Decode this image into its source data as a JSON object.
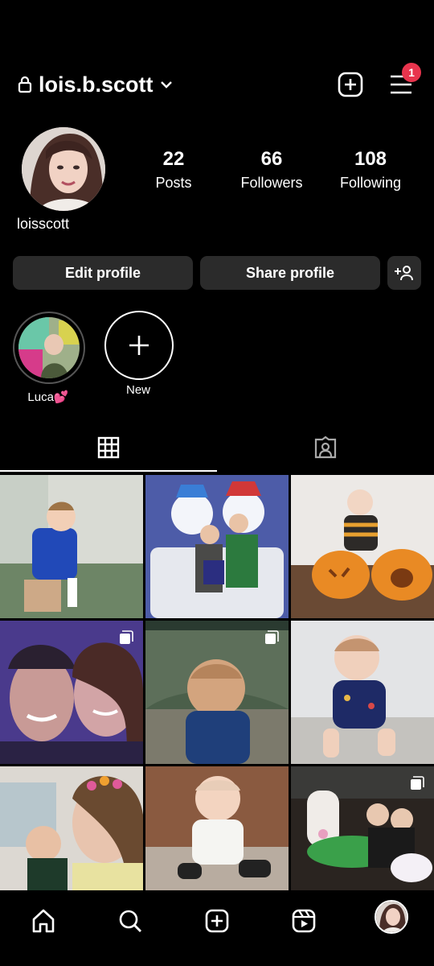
{
  "header": {
    "username": "lois.b.scott",
    "notification_count": "1",
    "icons": [
      "lock-icon",
      "chevron-down-icon",
      "create-icon",
      "menu-icon"
    ]
  },
  "profile": {
    "display_name": "loisscott",
    "stats": [
      {
        "value": "22",
        "label": "Posts"
      },
      {
        "value": "66",
        "label": "Followers"
      },
      {
        "value": "108",
        "label": "Following"
      }
    ]
  },
  "actions": {
    "edit_label": "Edit profile",
    "share_label": "Share profile"
  },
  "highlights": [
    {
      "label": "Luca💕"
    },
    {
      "label": "New"
    }
  ],
  "tabs": [
    "grid-icon",
    "tagged-icon"
  ],
  "posts": [
    {
      "alt": "toddler in blue shirt",
      "multi": false
    },
    {
      "alt": "family with snowmen",
      "multi": false
    },
    {
      "alt": "baby with pumpkins",
      "multi": false
    },
    {
      "alt": "couple selfie",
      "multi": true
    },
    {
      "alt": "child at aquarium",
      "multi": true
    },
    {
      "alt": "baby in space pyjamas",
      "multi": false
    },
    {
      "alt": "mother with baby",
      "multi": false
    },
    {
      "alt": "baby sitting on floor",
      "multi": false
    },
    {
      "alt": "friends with inflatables",
      "multi": true
    }
  ],
  "colors": {
    "background": "#000000",
    "button": "#2b2b2b",
    "badge": "#e8344d"
  },
  "bottom_nav": [
    "home-icon",
    "search-icon",
    "create-icon",
    "reels-icon",
    "profile-avatar"
  ]
}
